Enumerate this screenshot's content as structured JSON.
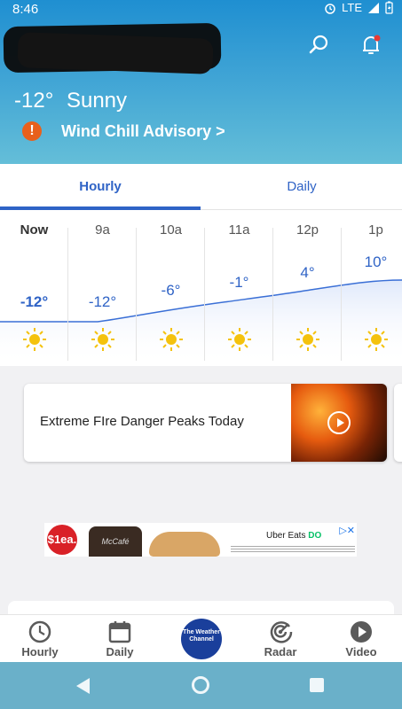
{
  "status_bar": {
    "time": "8:46",
    "network": "LTE"
  },
  "header": {
    "account_label": ""
  },
  "current": {
    "temp": "-12°",
    "condition": "Sunny"
  },
  "alert": {
    "text": "Wind Chill Advisory >",
    "icon": "warning-icon",
    "color": "#e8601c"
  },
  "tabs": [
    {
      "label": "Hourly"
    },
    {
      "label": "Daily"
    }
  ],
  "hourly": [
    {
      "time": "Now",
      "temp": "-12°",
      "icon": "sun-icon"
    },
    {
      "time": "9a",
      "temp": "-12°",
      "icon": "sun-icon"
    },
    {
      "time": "10a",
      "temp": "-6°",
      "icon": "sun-icon"
    },
    {
      "time": "11a",
      "temp": "-1°",
      "icon": "sun-icon"
    },
    {
      "time": "12p",
      "temp": "4°",
      "icon": "sun-icon"
    },
    {
      "time": "1p",
      "temp": "10°",
      "icon": "sun-icon"
    }
  ],
  "news": {
    "title": "Extreme FIre Danger Peaks Today",
    "icon": "play-icon"
  },
  "ad": {
    "price": "$1ea.",
    "cup_text": "McCafé",
    "brand": "Uber Eats",
    "brand_tail": "DO"
  },
  "nav": [
    {
      "label": "Hourly",
      "icon": "clock-icon"
    },
    {
      "label": "Daily",
      "icon": "calendar-icon"
    },
    {
      "label": "Radar",
      "icon": "radar-icon"
    },
    {
      "label": "Video",
      "icon": "play-circle-icon"
    }
  ],
  "logo": {
    "text": "The Weather Channel"
  },
  "colors": {
    "accent": "#2f63c6",
    "header": "#3ea3d5",
    "alert": "#e8601c",
    "logo": "#1a3f9b"
  }
}
